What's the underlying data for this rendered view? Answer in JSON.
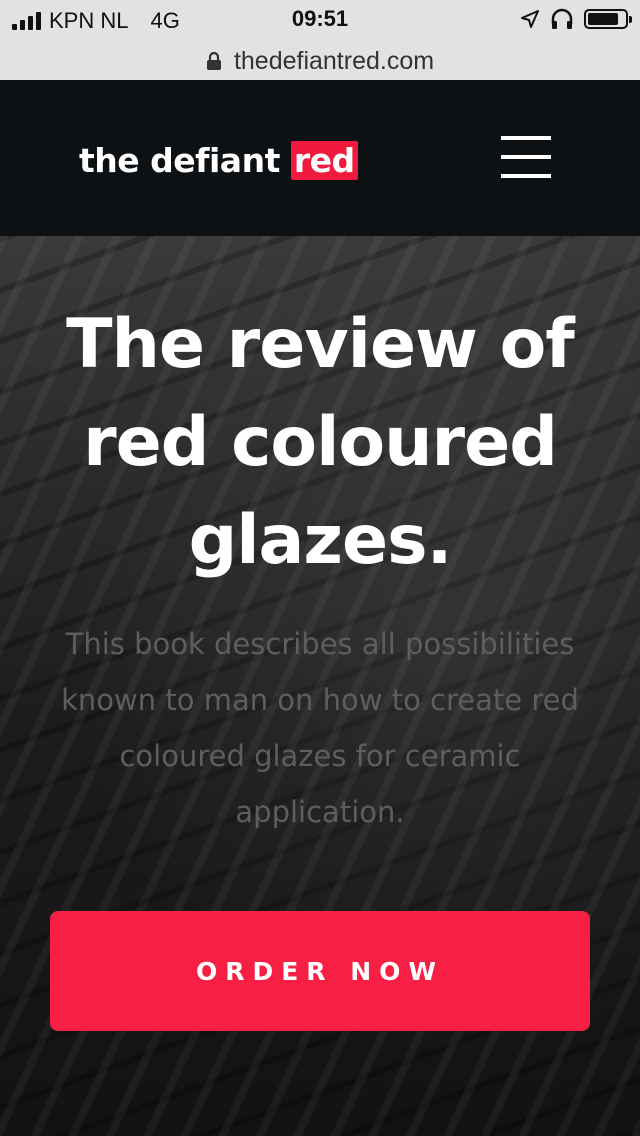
{
  "status_bar": {
    "carrier": "KPN NL",
    "network": "4G",
    "time": "09:51",
    "icons": [
      "signal-bars-icon",
      "location-arrow-icon",
      "headphones-icon",
      "battery-icon"
    ],
    "battery_level": 0.85
  },
  "url_bar": {
    "url": "thedefiantred.com",
    "icon": "lock-icon"
  },
  "header": {
    "logo_text": "the defiant",
    "logo_highlight": "red",
    "menu_icon": "hamburger-menu-icon",
    "colors": {
      "background": "#0d1114",
      "logo_highlight": "#f01a3e"
    }
  },
  "hero": {
    "headline": "The review of red coloured glazes.",
    "description": "This book describes all possibilities known to man on how to create red coloured glazes for ceramic application.",
    "cta_label": "ORDER NOW",
    "colors": {
      "cta_background": "#f71f44",
      "description_text": "#5e5e5e"
    }
  }
}
